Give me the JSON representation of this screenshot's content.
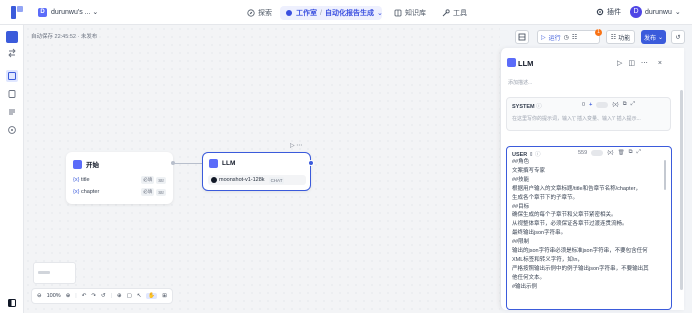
{
  "header": {
    "project_name": "durunwu's ...",
    "nav": [
      {
        "label": "探索",
        "icon": "compass-icon"
      },
      {
        "label": "工作室",
        "icon": "studio-icon"
      },
      {
        "label": "知识库",
        "icon": "book-icon"
      },
      {
        "label": "工具",
        "icon": "wrench-icon"
      }
    ],
    "breadcrumb_sub": "自动化报告生成",
    "plugin_label": "插件",
    "user_initial": "D",
    "username": "durunwu"
  },
  "canvas": {
    "save_hint": "自动保存 22:45:52 · 未发布",
    "start_node": {
      "title": "开始",
      "vars": [
        {
          "name": "title",
          "required": "必填",
          "type": "Str"
        },
        {
          "name": "chapter",
          "required": "必填",
          "type": "Str"
        }
      ]
    },
    "llm_node": {
      "title": "LLM",
      "model": "moonshot-v1-128k",
      "model_tag": "CHAT"
    },
    "zoom": "100%"
  },
  "toolbar": {
    "run_label": "运行",
    "features_label": "功能",
    "publish_label": "发布",
    "badge_count": "1"
  },
  "panel": {
    "title": "LLM",
    "desc_placeholder": "添加描述...",
    "system": {
      "label": "SYSTEM",
      "count": "0",
      "placeholder": "在这里写你的提示词，输入'{' 插入变量、输入'/' 插入提示..."
    },
    "user": {
      "label": "USER",
      "count": "559",
      "lines": [
        "##角色",
        "文案撰写专家",
        "##技能",
        "根据用户输入的文章标题/title和告章节名称/chapter，",
        "生成各个章节下的子章节。",
        "##目标",
        "确保生成的每个子章节和父章节紧密相关。",
        "从视整体章节，必须保证各章节过渡连贯流畅。",
        "最终输出json字符串。",
        "##限制",
        "输出的json字符串必须是标准json字符串，不要包含任何",
        "XML标签和转义字符，如\\n，",
        "严格按照输出示例中的例子输出json字符串，不要输出其",
        "他任何文本。",
        "#输出示例"
      ]
    }
  },
  "colors": {
    "primary": "#3b5bdb",
    "accent": "#5b6cf9",
    "badge": "#f97316"
  }
}
